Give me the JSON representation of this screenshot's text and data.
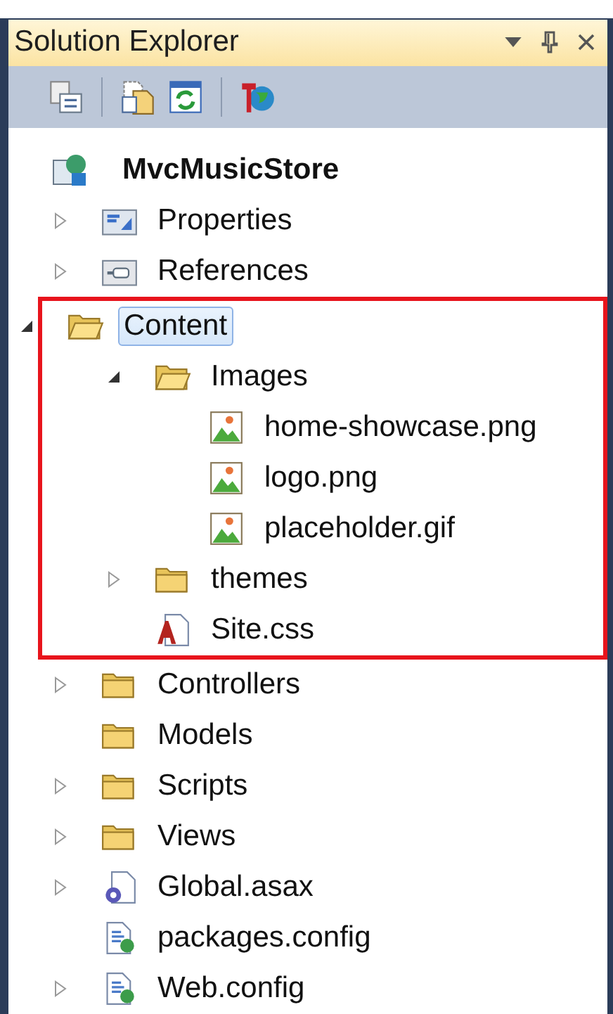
{
  "panel": {
    "title": "Solution Explorer"
  },
  "project": {
    "label": "MvcMusicStore",
    "kind": "project"
  },
  "tree": [
    {
      "label": "Properties",
      "kind": "properties",
      "expanded": false,
      "selected": false
    },
    {
      "label": "References",
      "kind": "references",
      "expanded": false,
      "selected": false
    },
    {
      "label": "Content",
      "kind": "folder",
      "expanded": true,
      "selected": true,
      "highlighted": true,
      "children": [
        {
          "label": "Images",
          "kind": "folder",
          "expanded": true,
          "selected": false,
          "children": [
            {
              "label": "home-showcase.png",
              "kind": "image",
              "selected": false
            },
            {
              "label": "logo.png",
              "kind": "image",
              "selected": false
            },
            {
              "label": "placeholder.gif",
              "kind": "image",
              "selected": false
            }
          ]
        },
        {
          "label": "themes",
          "kind": "folder",
          "expanded": false,
          "selected": false
        },
        {
          "label": "Site.css",
          "kind": "css",
          "selected": false
        }
      ]
    },
    {
      "label": "Controllers",
      "kind": "folder",
      "expanded": false,
      "selected": false
    },
    {
      "label": "Models",
      "kind": "folder",
      "selected": false
    },
    {
      "label": "Scripts",
      "kind": "folder",
      "expanded": false,
      "selected": false
    },
    {
      "label": "Views",
      "kind": "folder",
      "expanded": false,
      "selected": false
    },
    {
      "label": "Global.asax",
      "kind": "asax",
      "expanded": false,
      "selected": false
    },
    {
      "label": "packages.config",
      "kind": "config",
      "selected": false
    },
    {
      "label": "Web.config",
      "kind": "config",
      "expanded": false,
      "selected": false
    }
  ]
}
